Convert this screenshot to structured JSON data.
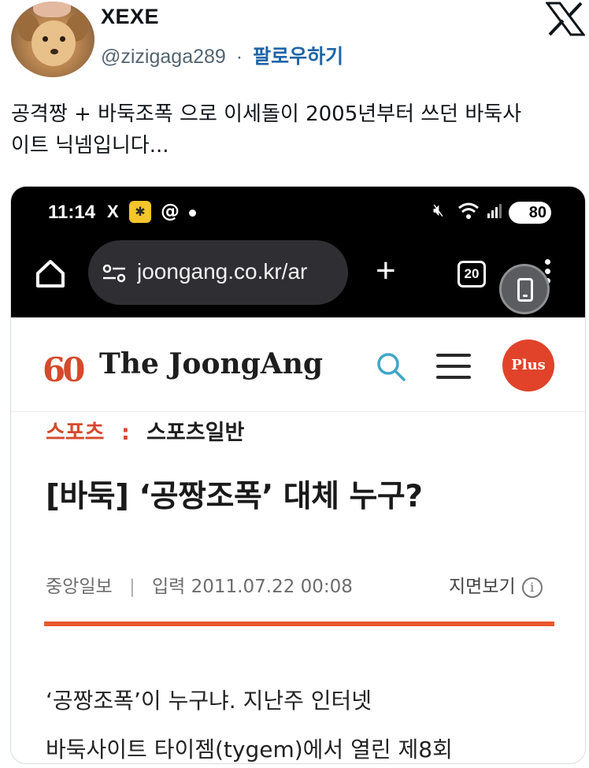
{
  "tweet": {
    "author_name": "XEXE",
    "handle": "@zizigaga289",
    "separator": "·",
    "follow_label": "팔로우하기",
    "text_line1": "공격짱 + 바둑조폭 으로 이세돌이 2005년부터 쓰던 바둑사",
    "text_line2": "이트 닉넴입니다..."
  },
  "phone": {
    "status_bar": {
      "time": "11:14",
      "x_app": "X",
      "app_icon": "kakao-like-icon",
      "threads": "ɕ",
      "battery": "80"
    },
    "browser": {
      "url": "joongang.co.kr/ar",
      "new_tab": "+",
      "tab_count": "20"
    },
    "site": {
      "logo_number": "60",
      "logo_text": "The JoongAng",
      "plus_label": "Plus"
    },
    "article": {
      "category": "스포츠",
      "category_sep": ":",
      "subcategory": "스포츠일반",
      "headline": "[바둑] ‘공짱조폭’ 대체 누구?",
      "source": "중앙일보",
      "meta_sep": "|",
      "published": "입력 2011.07.22 00:08",
      "paper_view": "지면보기",
      "body_line1": "‘공짱조폭’이 누구냐. 지난주 인터넷",
      "body_line2": "바둑사이트 타이젬(tygem)에서 열린 제8회"
    }
  },
  "colors": {
    "accent_red": "#d54a2c",
    "follow_blue": "#1d64a8",
    "rule_orange": "#e8582f"
  }
}
